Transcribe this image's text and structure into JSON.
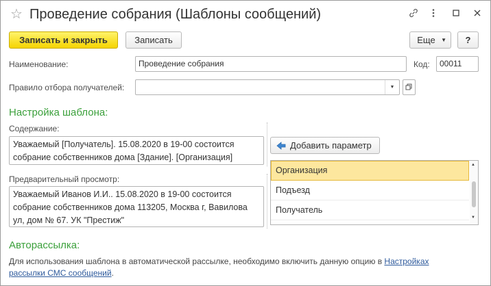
{
  "window": {
    "title": "Проведение собрания (Шаблоны сообщений)",
    "controls": {
      "link": "🔗",
      "more": "⋮",
      "maximize": "☐",
      "close": "✕"
    }
  },
  "toolbar": {
    "save_close_label": "Записать и закрыть",
    "save_label": "Записать",
    "more_label": "Еще",
    "help_label": "?"
  },
  "form": {
    "name_label": "Наименование:",
    "name_value": "Проведение собрания",
    "code_label": "Код:",
    "code_value": "00011",
    "rule_label": "Правило отбора получателей:",
    "rule_value": ""
  },
  "template_settings": {
    "heading": "Настройка шаблона:",
    "content_label": "Содержание:",
    "content_lines": [
      "Уважаемый [Получатель]. 15.08.2020 в 19-00 состоится",
      "собрание собственников дома [Здание]. [Организация]"
    ],
    "preview_label": "Предварительный просмотр:",
    "preview_lines": [
      "Уважаемый Иванов И.И.. 15.08.2020 в 19-00 состоится",
      "собрание собственников дома 113205, Москва г, Вавилова",
      "ул, дом № 67. УК \"Престиж\""
    ],
    "add_param_label": "Добавить параметр",
    "params": [
      "Организация",
      "Подъезд",
      "Получатель"
    ],
    "selected_param": "Организация"
  },
  "autosend": {
    "heading": "Авторассылка:",
    "text_before": "Для использования шаблона в автоматической рассылке, необходимо включить данную опцию в ",
    "link_line1": "Настройках",
    "link_line2": "рассылки СМС сообщений",
    "text_after": "."
  },
  "colors": {
    "accent_green": "#3ba03b",
    "primary_button": "#f5d400",
    "selection": "#fde79e",
    "link": "#2e5a9c"
  }
}
